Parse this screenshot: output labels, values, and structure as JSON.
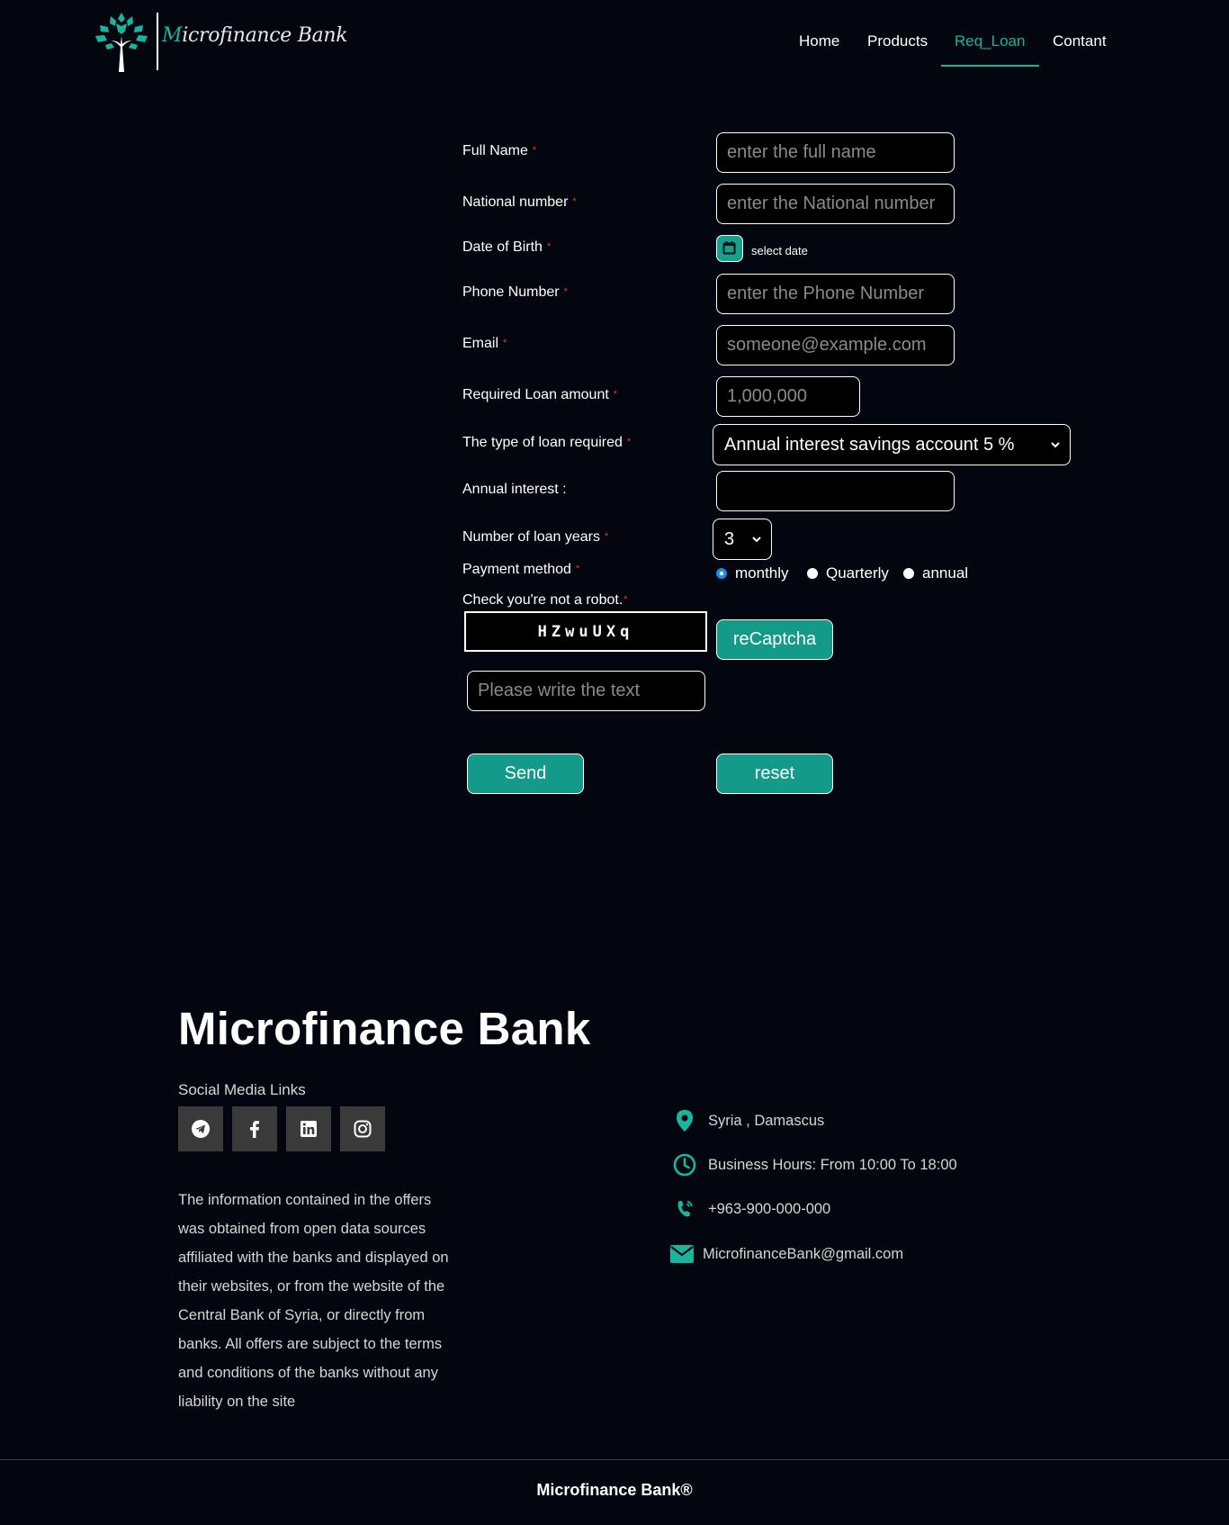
{
  "header": {
    "logo_text_first": "M",
    "logo_text_rest": "icrofinance Bank",
    "nav": [
      {
        "label": "Home",
        "active": false
      },
      {
        "label": "Products",
        "active": false
      },
      {
        "label": "Req_Loan",
        "active": true
      },
      {
        "label": "Contant",
        "active": false
      }
    ]
  },
  "form": {
    "full_name": {
      "label": "Full Name",
      "placeholder": "enter the full name"
    },
    "national_number": {
      "label": "National number",
      "placeholder": "enter the National number"
    },
    "dob": {
      "label": "Date of Birth",
      "button_text": "select date",
      "icon": "calendar-icon"
    },
    "phone": {
      "label": "Phone Number",
      "placeholder": "enter the Phone Number"
    },
    "email": {
      "label": "Email",
      "placeholder": "someone@example.com"
    },
    "loan_amount": {
      "label": "Required Loan amount",
      "placeholder": "1,000,000"
    },
    "loan_type": {
      "label": "The type of loan required",
      "selected": "Annual interest savings account 5 %"
    },
    "annual_interest": {
      "label": "Annual interest :",
      "value": ""
    },
    "loan_years": {
      "label": "Number of loan years",
      "selected": "3"
    },
    "payment_method": {
      "label": "Payment method",
      "options": [
        {
          "label": "monthly",
          "checked": true
        },
        {
          "label": "Quarterly",
          "checked": false
        },
        {
          "label": "annual",
          "checked": false
        }
      ]
    },
    "captcha": {
      "label": "Check you're not a robot.",
      "code": "HZwuUXq",
      "button": "reCaptcha",
      "placeholder": "Please write the text"
    },
    "required_mark": "*",
    "send_label": "Send",
    "reset_label": "reset"
  },
  "footer": {
    "title": "Microfinance Bank",
    "social_label": "Social Media Links",
    "social_icons": [
      "telegram-icon",
      "facebook-icon",
      "linkedin-icon",
      "instagram-icon"
    ],
    "info": "The information contained in the offers was obtained from open data sources affiliated with the banks and displayed on their websites, or from the website of the Central Bank of Syria, or directly from banks. All offers are subject to the terms and conditions of the banks without any liability on the site",
    "contacts": [
      {
        "icon": "location-pin-icon",
        "text": "Syria , Damascus"
      },
      {
        "icon": "clock-icon",
        "text": "Business Hours: From 10:00 To 18:00"
      },
      {
        "icon": "phone-icon",
        "text": "+963-900-000-000"
      },
      {
        "icon": "envelope-icon",
        "text": "MicrofinanceBank@gmail.com"
      }
    ],
    "copyright": "Microfinance Bank®"
  },
  "colors": {
    "accent": "#19b59c",
    "button": "#139a88",
    "background": "#03060f",
    "required": "#e53935"
  }
}
